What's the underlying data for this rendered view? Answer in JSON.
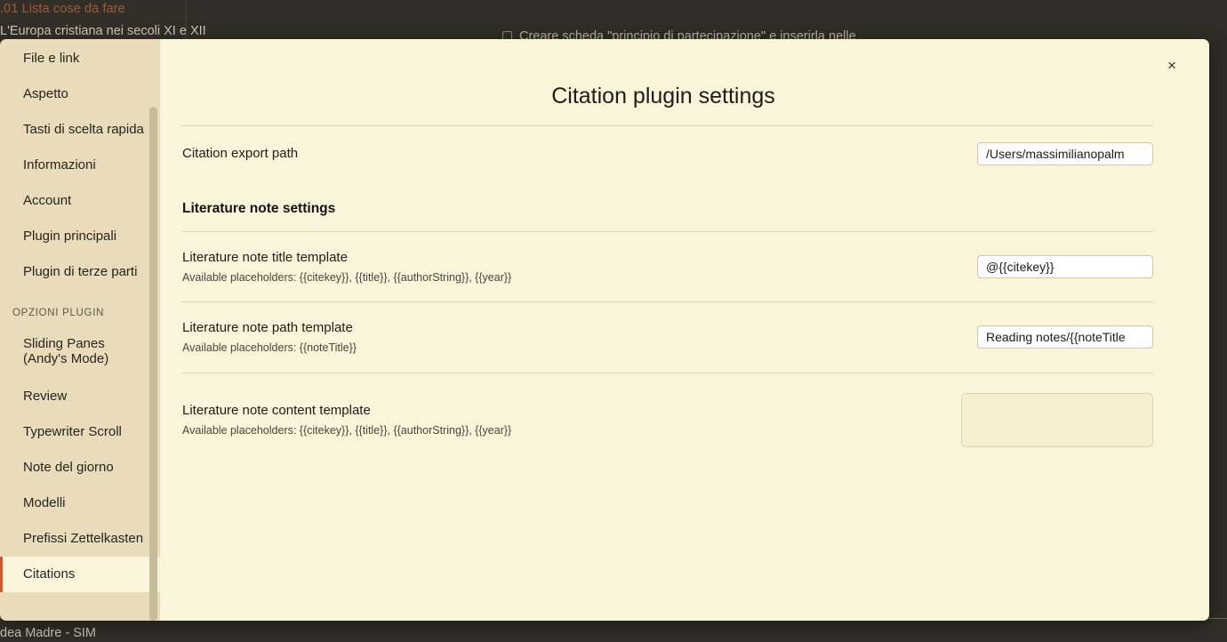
{
  "app_background": {
    "note_title": ".01 Lista cose da fare",
    "note_heading": "L'Europa cristiana nei secoli XI e XII",
    "task_line": "Creare scheda \"principio di partecipazione\" e inserirla nelle",
    "bottom_strip_label": "dea Madre - SIM"
  },
  "modal": {
    "title": "Citation plugin settings",
    "close_label": "×"
  },
  "sidebar": {
    "items": [
      {
        "label": "File e link",
        "active": false
      },
      {
        "label": "Aspetto",
        "active": false
      },
      {
        "label": "Tasti di scelta rapida",
        "active": false
      },
      {
        "label": "Informazioni",
        "active": false
      },
      {
        "label": "Account",
        "active": false
      },
      {
        "label": "Plugin principali",
        "active": false
      },
      {
        "label": "Plugin di terze parti",
        "active": false
      }
    ],
    "group_label": "OPZIONI PLUGIN",
    "plugin_items": [
      {
        "label_line1": "Sliding Panes",
        "label_line2": "(Andy's Mode)",
        "active": false
      },
      {
        "label_line1": "Review",
        "label_line2": "",
        "active": false
      },
      {
        "label_line1": "Typewriter Scroll",
        "label_line2": "",
        "active": false
      },
      {
        "label_line1": "Note del giorno",
        "label_line2": "",
        "active": false
      },
      {
        "label_line1": "Modelli",
        "label_line2": "",
        "active": false
      },
      {
        "label_line1": "Prefissi Zettelkasten",
        "label_line2": "",
        "active": false
      },
      {
        "label_line1": "Citations",
        "label_line2": "",
        "active": true
      }
    ]
  },
  "settings": {
    "export_path": {
      "name": "Citation export path",
      "value": "/Users/massimilianopalm"
    },
    "section_heading": "Literature note settings",
    "title_template": {
      "name": "Literature note title template",
      "description": "Available placeholders: {{citekey}}, {{title}}, {{authorString}}, {{year}}",
      "value": "@{{citekey}}"
    },
    "path_template": {
      "name": "Literature note path template",
      "description": "Available placeholders: {{noteTitle}}",
      "value": "Reading notes/{{noteTitle"
    },
    "content_template": {
      "name": "Literature note content template",
      "description": "Available placeholders: {{citekey}}, {{title}}, {{authorString}}, {{year}}",
      "value": ""
    }
  },
  "colors": {
    "modal_background": "#faf4da",
    "sidebar_background": "#e8dcbb",
    "active_accent": "#d4562a",
    "app_background": "#2f2d26"
  }
}
